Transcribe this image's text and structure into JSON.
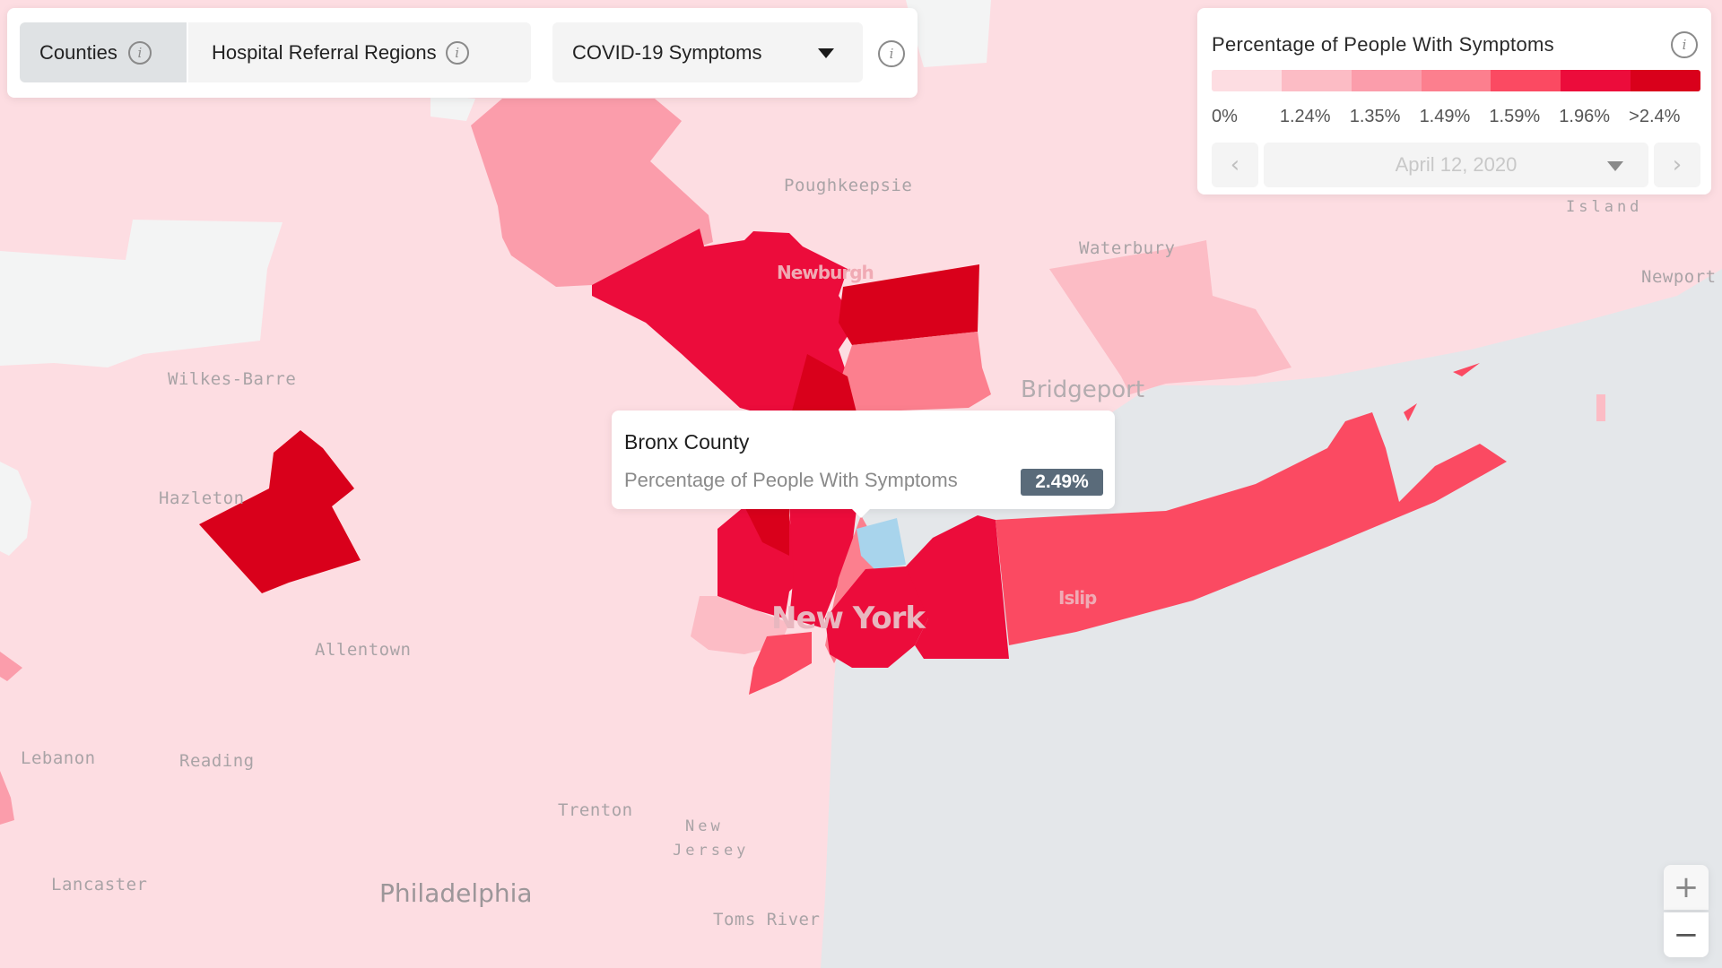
{
  "toolbar": {
    "tabs": [
      {
        "label": "Counties",
        "active": true
      },
      {
        "label": "Hospital Referral Regions",
        "active": false
      }
    ],
    "metric_select": {
      "selected": "COVID-19 Symptoms"
    },
    "icons": {
      "info": "info-icon",
      "dropdown": "caret-down-icon"
    }
  },
  "legend": {
    "title": "Percentage of People With Symptoms",
    "colors": [
      "#fddde2",
      "#fcbcc5",
      "#fb9dab",
      "#fc7f8e",
      "#fb4a62",
      "#ec0c3b",
      "#d9001b"
    ],
    "ticks": [
      "0%",
      "1.24%",
      "1.35%",
      "1.49%",
      "1.59%",
      "1.96%",
      ">2.4%"
    ],
    "date": "April 12, 2020",
    "prev_icon": "chevron-left-icon",
    "next_icon": "chevron-right-icon"
  },
  "tooltip": {
    "region": "Bronx County",
    "metric": "Percentage of People With Symptoms",
    "value": "2.49%"
  },
  "map": {
    "colors": {
      "water": "#e4e7ea",
      "land_default": "#fddde2",
      "no_data": "#f3f4f4",
      "highlight": "#a8d4ec"
    },
    "labels": {
      "poughkeepsie": "Poughkeepsie",
      "newburgh": "Newburgh",
      "waterbury": "Waterbury",
      "bridgeport": "Bridgeport",
      "island": "Island",
      "newport": "Newport",
      "wilkes_barre": "Wilkes-Barre",
      "hazleton": "Hazleton",
      "allentown": "Allentown",
      "lebanon": "Lebanon",
      "reading": "Reading",
      "lancaster": "Lancaster",
      "philadelphia": "Philadelphia",
      "trenton": "Trenton",
      "new": "New",
      "jersey": "Jersey",
      "toms_river": "Toms River",
      "new_york": "New York",
      "islip": "Islip"
    }
  },
  "zoom_controls": {
    "zoom_in": "+",
    "zoom_out": "−"
  }
}
